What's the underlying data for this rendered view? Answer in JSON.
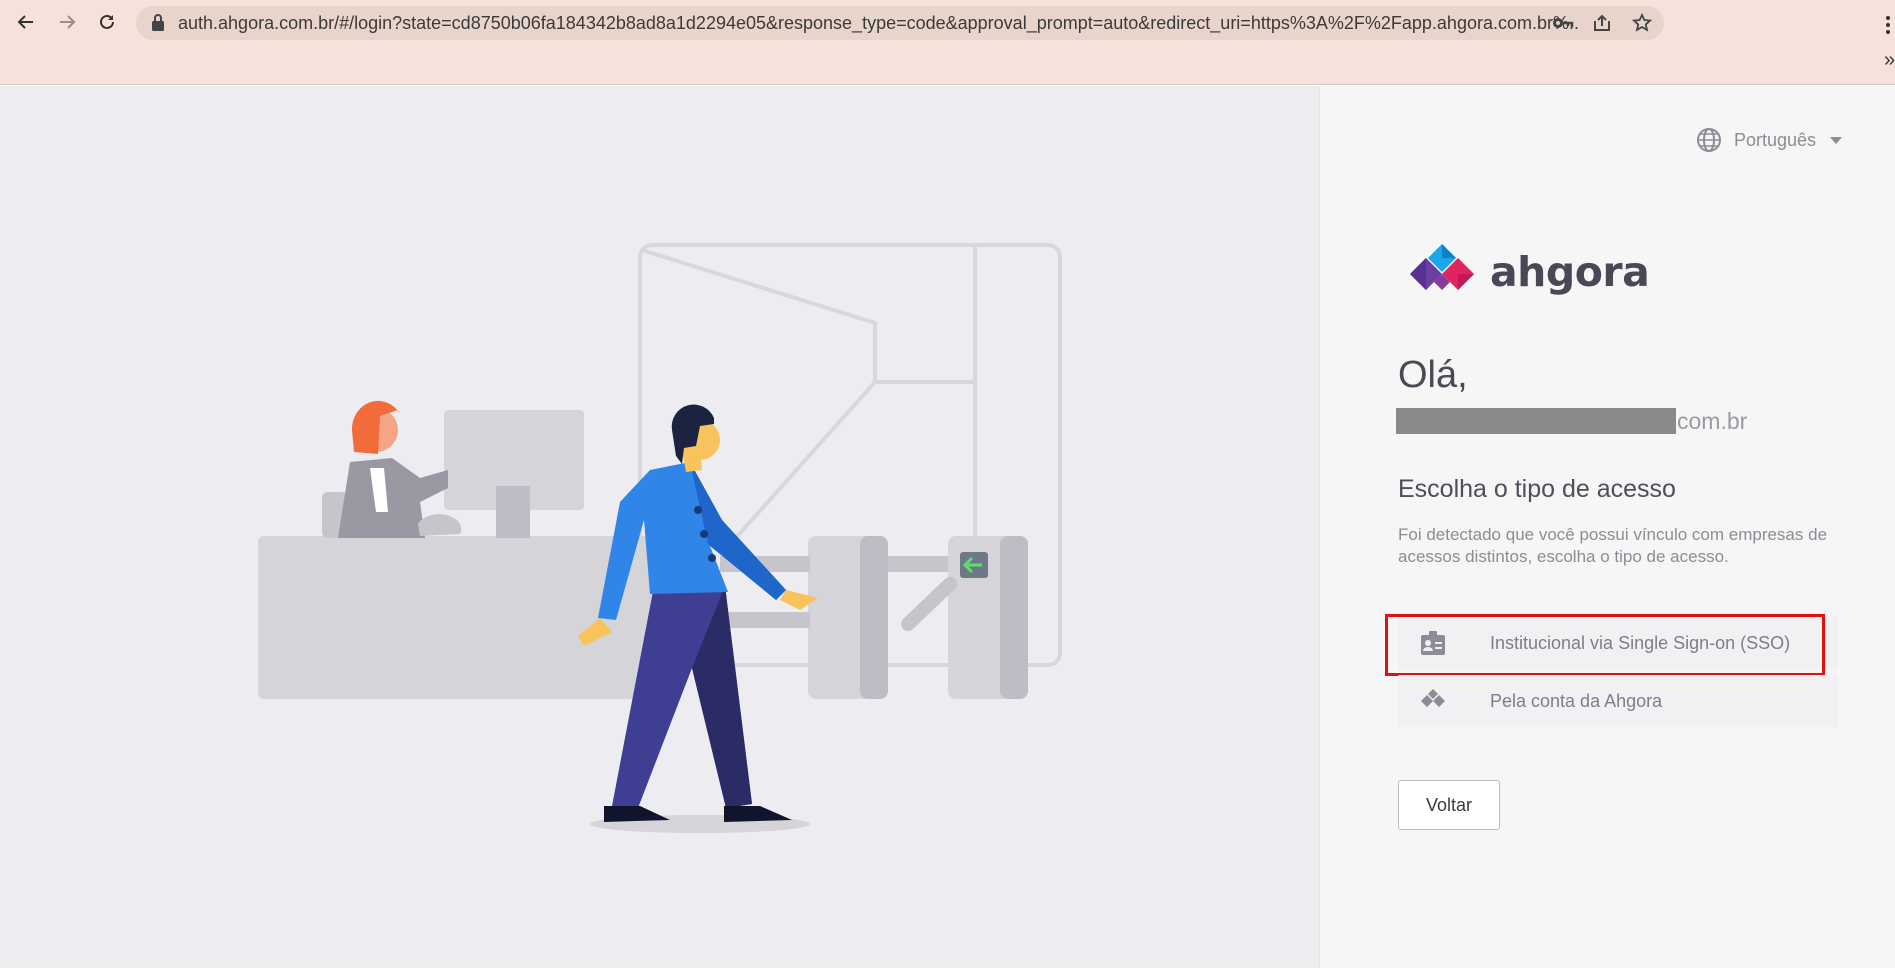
{
  "browser": {
    "url": "auth.ahgora.com.br/#/login?state=cd8750b06fa184342b8ad8a1d2294e05&response_type=code&approval_prompt=auto&redirect_uri=https%3A%2F%2Fapp.ahgora.com.br%...",
    "extensions_chevron": "»",
    "icons": [
      "back-arrow-icon",
      "forward-arrow-icon",
      "reload-icon",
      "lock-icon",
      "key-icon",
      "share-icon",
      "star-icon",
      "kebab-menu-icon"
    ]
  },
  "language": {
    "label": "Português",
    "icon": "globe-icon"
  },
  "brand": {
    "name": "ahgora",
    "colors": {
      "dark": "#4a4857",
      "blue": "#1aa6e8",
      "purple": "#6a3fa0",
      "pink": "#e0245e",
      "red": "#c2185b"
    }
  },
  "greeting": {
    "hello": "Olá,",
    "email_suffix": "com.br"
  },
  "access": {
    "title": "Escolha o tipo de acesso",
    "description": "Foi detectado que você possui vínculo com empresas de acessos distintos, escolha o tipo de acesso.",
    "options": [
      {
        "label": "Institucional via Single Sign-on (SSO)",
        "icon": "id-badge-icon"
      },
      {
        "label": "Pela conta da Ahgora",
        "icon": "ahgora-diamond-icon"
      }
    ],
    "back_label": "Voltar"
  },
  "colors": {
    "highlight": "#e01010",
    "panel_bg": "#f6f6f7",
    "illustration_bg": "#edecf1",
    "browser_bg": "#f6e2da"
  }
}
